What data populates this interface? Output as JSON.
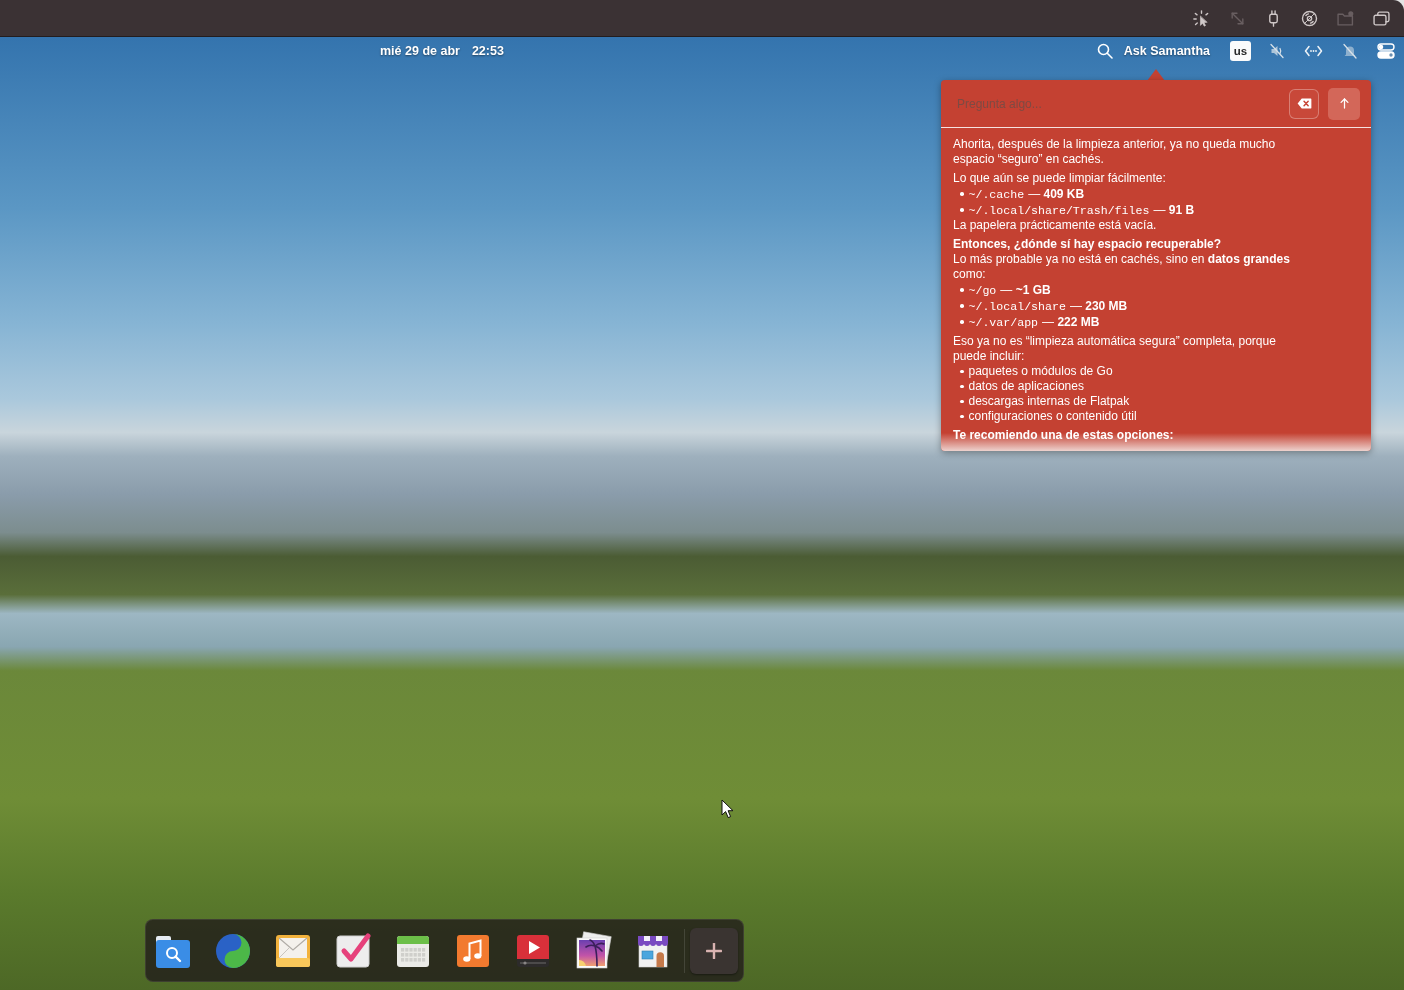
{
  "window_bar": {
    "buttons": [
      {
        "disabled": false
      },
      {
        "disabled": true
      },
      {
        "disabled": false
      },
      {
        "disabled": false
      },
      {
        "disabled": true
      },
      {
        "disabled": false
      }
    ]
  },
  "top_panel": {
    "date": "mié 29 de abr",
    "time": "22:53",
    "assistant_label": "Ask Samantha",
    "keyboard_layout": "us"
  },
  "assistant_popup": {
    "input": {
      "placeholder": "Pregunta algo..."
    },
    "sections": [
      {
        "blocks": [
          {
            "kind": "text",
            "text": "Ahorita, después de la limpieza anterior, ya no queda mucho espacio “seguro” en cachés."
          }
        ]
      },
      {
        "blocks": [
          {
            "kind": "text",
            "text": "Lo que aún se puede limpiar fácilmente:"
          },
          {
            "kind": "paths",
            "items": [
              {
                "path": "~/.cache",
                "detail": "— **409 KB**"
              },
              {
                "path": "~/.local/share/Trash/files",
                "detail": "— **91 B**"
              }
            ]
          },
          {
            "kind": "text",
            "text": "La papelera prácticamente está vacía."
          }
        ]
      },
      {
        "blocks": [
          {
            "kind": "heading",
            "text": "Entonces, ¿dónde sí hay espacio recuperable?"
          },
          {
            "kind": "text",
            "text": "Lo más probable ya no está en cachés, sino en **datos grandes** como:"
          },
          {
            "kind": "paths",
            "items": [
              {
                "path": "~/go",
                "detail": "— **~1 GB**"
              },
              {
                "path": "~/.local/share",
                "detail": "— **230 MB**"
              },
              {
                "path": "~/.var/app",
                "detail": "— **222 MB**"
              }
            ]
          }
        ]
      },
      {
        "blocks": [
          {
            "kind": "text",
            "text": "Eso ya no es “limpieza automática segura” completa, porque puede incluir:"
          },
          {
            "kind": "list",
            "items": [
              "paquetes o módulos de Go",
              "datos de aplicaciones",
              "descargas internas de Flatpak",
              "configuraciones o contenido útil"
            ]
          }
        ]
      },
      {
        "blocks": [
          {
            "kind": "heading",
            "text": "Te recomiendo una de estas opciones:"
          }
        ]
      }
    ]
  }
}
